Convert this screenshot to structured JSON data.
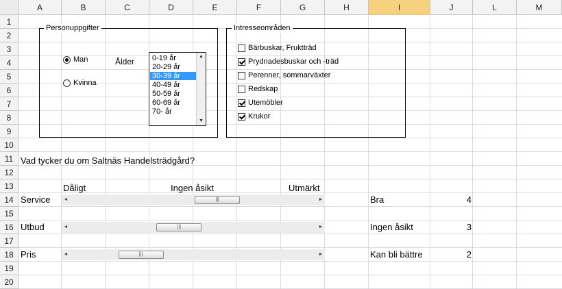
{
  "columns": [
    "A",
    "B",
    "C",
    "D",
    "E",
    "F",
    "G",
    "H",
    "I",
    "J",
    "L",
    "M"
  ],
  "rows": [
    "1",
    "2",
    "3",
    "4",
    "5",
    "6",
    "7",
    "8",
    "9",
    "10",
    "11",
    "12",
    "13",
    "14",
    "15",
    "16",
    "17",
    "18",
    "19",
    "20"
  ],
  "selected_column": "I",
  "personuppgifter": {
    "title": "Personuppgifter",
    "radio_man": "Man",
    "radio_kvinna": "Kvinna",
    "selected_gender": "Man",
    "alder_label": "Ålder",
    "age_options": [
      "0-19 år",
      "20-29 år",
      "30-39  år",
      "40-49  år",
      "50-59 år",
      "60-69 år",
      "70- år"
    ],
    "selected_age": "30-39  år"
  },
  "intresseomraden": {
    "title": "Intresseområden",
    "items": [
      {
        "label": "Bärbuskar, Fruktträd",
        "checked": false
      },
      {
        "label": "Prydnadesbuskar och -träd",
        "checked": true
      },
      {
        "label": "Perenner, sommarväxter",
        "checked": false
      },
      {
        "label": "Redskap",
        "checked": false
      },
      {
        "label": "Utemöbler",
        "checked": true
      },
      {
        "label": "Krukor",
        "checked": true
      }
    ]
  },
  "question": "Vad tycker du om Saltnäs Handelsträdgård?",
  "scale": {
    "low": "Dåligt",
    "mid": "Ingen åsikt",
    "high": "Utmärkt"
  },
  "sliders": [
    {
      "label": "Service",
      "value_fraction": 0.62
    },
    {
      "label": "Utbud",
      "value_fraction": 0.43
    },
    {
      "label": "Pris",
      "value_fraction": 0.24
    }
  ],
  "summary": [
    {
      "label": "Bra",
      "value": "4"
    },
    {
      "label": "Ingen åsikt",
      "value": "3"
    },
    {
      "label": "Kan bli bättre",
      "value": "2"
    }
  ],
  "icons": {
    "slider_thumb": "grip-icon",
    "left_arrow": "arrow-left-icon",
    "right_arrow": "arrow-right-icon",
    "list_up": "arrow-up-icon",
    "list_down": "arrow-down-icon"
  }
}
